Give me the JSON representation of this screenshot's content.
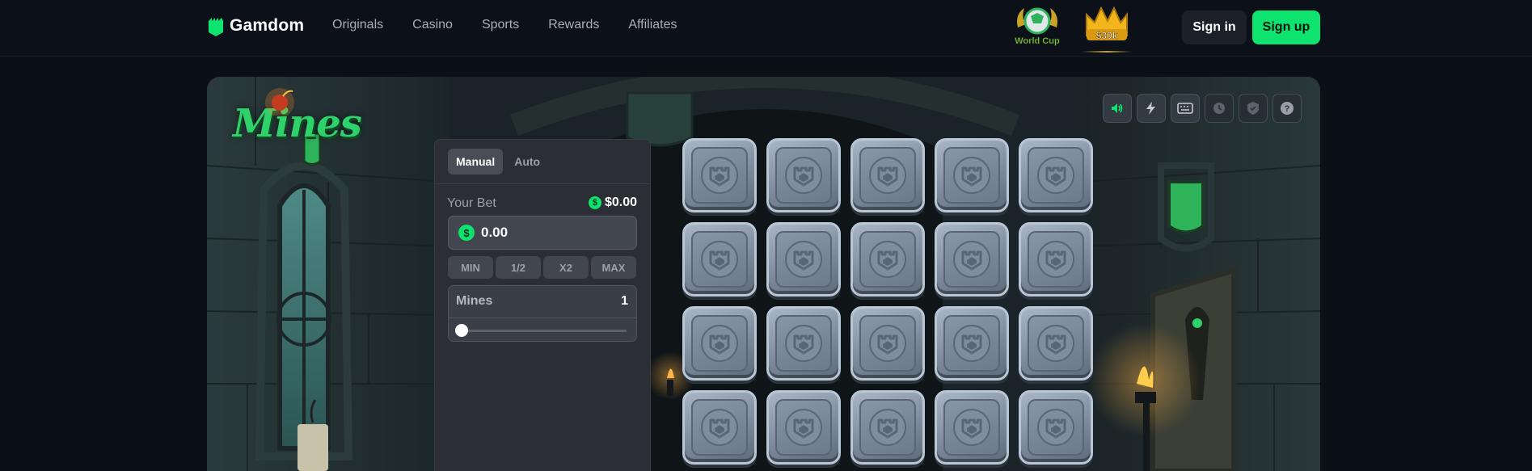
{
  "header": {
    "brand": "Gamdom",
    "nav": [
      "Originals",
      "Casino",
      "Sports",
      "Rewards",
      "Affiliates"
    ],
    "promos": {
      "world_cup": "World Cup",
      "prize": "$30k"
    },
    "signin_label": "Sign in",
    "signup_label": "Sign up"
  },
  "game": {
    "title": "Mines",
    "controls": [
      "sound-icon",
      "lightning-icon",
      "keyboard-icon",
      "history-icon",
      "fairness-icon",
      "help-icon"
    ],
    "panel": {
      "tabs": [
        {
          "label": "Manual",
          "active": true
        },
        {
          "label": "Auto",
          "active": false
        }
      ],
      "bet_label": "Your Bet",
      "bet_total": "$0.00",
      "currency_symbol": "$",
      "bet_value": "0.00",
      "quick_buttons": [
        "MIN",
        "1/2",
        "X2",
        "MAX"
      ],
      "mines_label": "Mines",
      "mines_count": "1",
      "mines_slider_fraction": 0
    },
    "board": {
      "rows": 4,
      "cols": 5,
      "visible_tiles": 20
    }
  },
  "colors": {
    "accent": "#0ee36f",
    "background": "#0b0f16",
    "panel": "#2b2e35",
    "tile": "#8796a7"
  }
}
